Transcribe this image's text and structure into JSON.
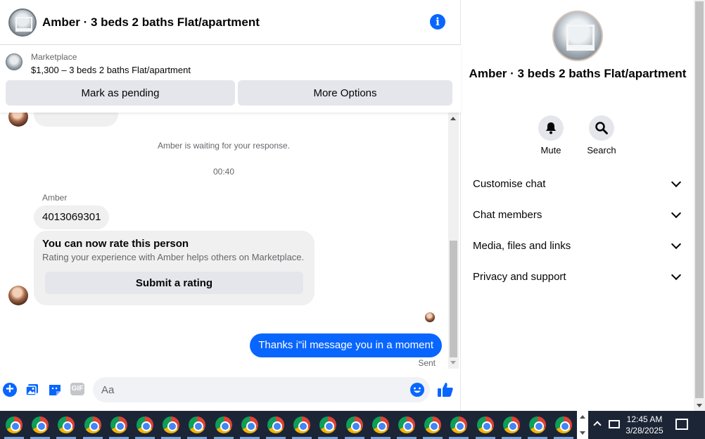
{
  "chat": {
    "title": "Amber · 3 beds 2 baths Flat/apartment",
    "marketplace_label": "Marketplace",
    "listing": "$1,300 – 3 beds 2 baths Flat/apartment",
    "mark_pending": "Mark as pending",
    "more_options": "More Options",
    "waiting": "Amber is waiting for your response.",
    "timestamp": "00:40",
    "sender": "Amber",
    "incoming_message": "4013069301",
    "rating_title": "You can now rate this person",
    "rating_sub": "Rating your experience with Amber helps others on Marketplace.",
    "rating_button": "Submit a rating",
    "outgoing_message": "Thanks i\"il message you in a moment",
    "status": "Sent",
    "input_placeholder": "Aa",
    "gif_label": "GIF"
  },
  "info_panel": {
    "title": "Amber · 3 beds 2 baths Flat/apartment",
    "actions": [
      {
        "label": "Mute",
        "icon": "bell-icon"
      },
      {
        "label": "Search",
        "icon": "search-icon"
      }
    ],
    "sections": [
      "Customise chat",
      "Chat members",
      "Media, files and links",
      "Privacy and support"
    ]
  },
  "taskbar": {
    "time": "12:45 AM",
    "date": "3/28/2025",
    "app_count": 22
  },
  "colors": {
    "accent": "#0866ff",
    "bubble_in": "#f0f0f0",
    "button_bg": "#e4e6eb",
    "taskbar": "#1c2536"
  }
}
